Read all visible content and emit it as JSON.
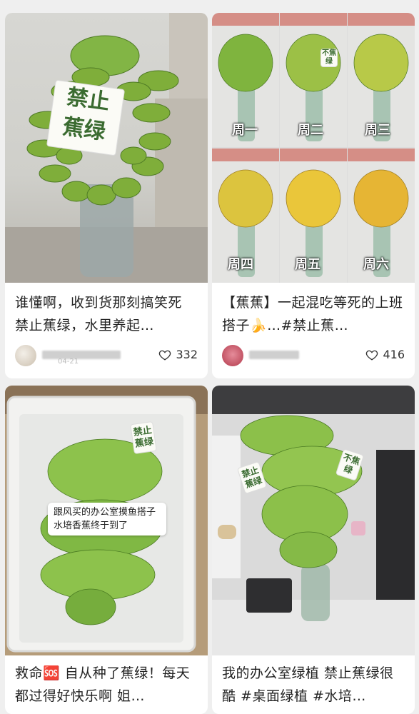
{
  "posts": [
    {
      "title": "谁懂啊，收到货那刻搞笑死 禁止蕉绿，水里养起…",
      "author": "",
      "date": "04-21",
      "likes": "332",
      "image_tag_line1": "禁止",
      "image_tag_line2": "蕉绿"
    },
    {
      "title": "【蕉蕉】一起混吃等死的上班搭子🍌…#禁止蕉…",
      "author": "",
      "likes": "416",
      "days": [
        "周一",
        "周二",
        "周三",
        "周四",
        "周五",
        "周六"
      ],
      "panel_tag": "不焦绿"
    },
    {
      "title": "救命🆘 自从种了蕉绿！每天都过得好快乐啊 姐…",
      "sticker_text": "跟风买的办公室摸鱼搭子水培香蕉终于到了",
      "tag_text": "禁止蕉绿"
    },
    {
      "title": "我的办公室绿植 禁止蕉绿很酷 #桌面绿植 #水培…",
      "tag_left": "禁止蕉绿",
      "tag_right": "不焦绿"
    }
  ],
  "colors": {
    "like_icon": "#333333",
    "banana_green": "#6fae3f",
    "banana_yellow": "#e9c338"
  },
  "icons": [
    "heart-icon"
  ]
}
